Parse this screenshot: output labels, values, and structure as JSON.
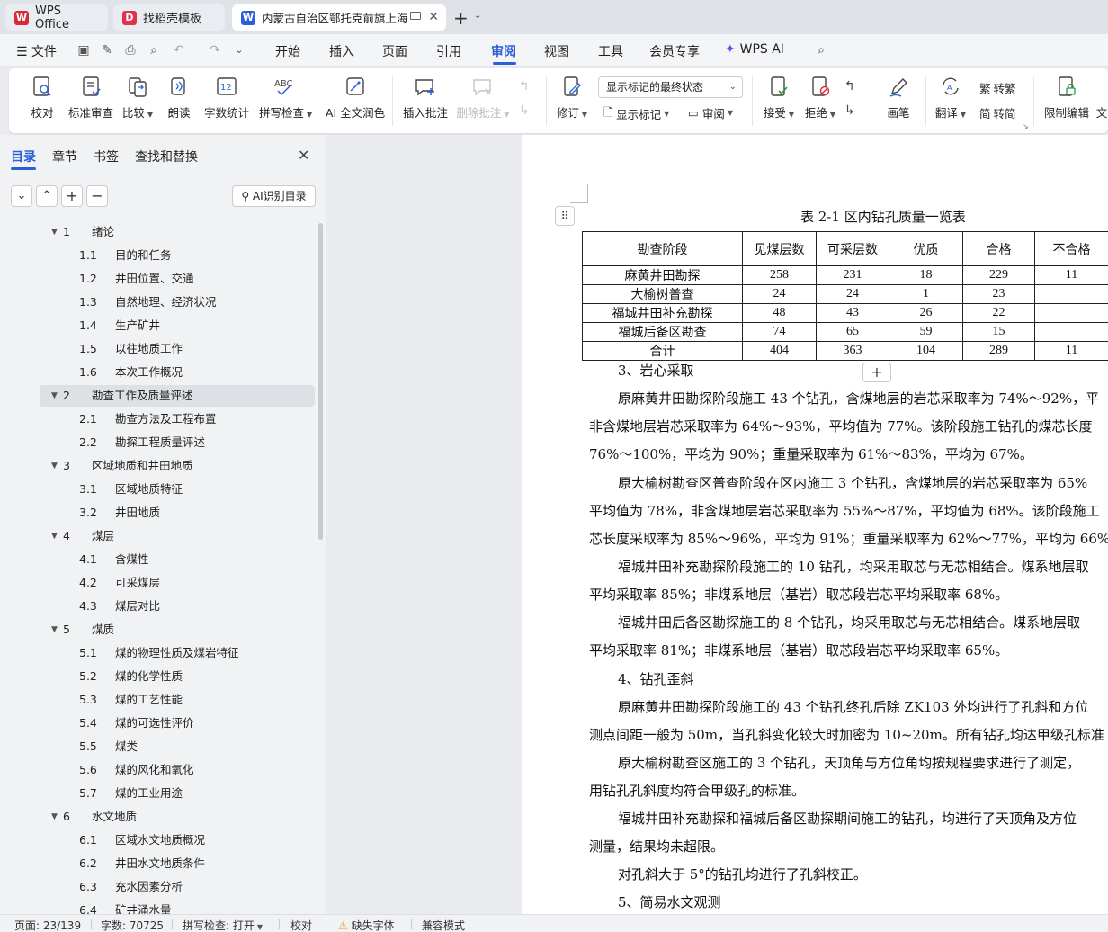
{
  "tabs": [
    {
      "label": "WPS Office",
      "icon": "wps-logo-icon",
      "color": "#d8283a"
    },
    {
      "label": "找稻壳模板",
      "icon": "docer-icon",
      "color": "#e0334a"
    },
    {
      "label": "内蒙古自治区鄂托克前旗上海",
      "icon": "writer-doc-icon",
      "color": "#2b5fd8"
    }
  ],
  "menubar": {
    "file": "文件",
    "items": [
      "开始",
      "插入",
      "页面",
      "引用",
      "审阅",
      "视图",
      "工具",
      "会员专享"
    ],
    "active": "审阅",
    "wps_ai": "WPS AI"
  },
  "ribbon": {
    "proofread": "校对",
    "standard_review": "标准审查",
    "compare": "比较",
    "read_aloud": "朗读",
    "word_count": "字数统计",
    "spell_check": "拼写检查",
    "ai_polish": "AI 全文润色",
    "insert_comment": "插入批注",
    "delete_comment": "删除批注",
    "track_changes": "修订",
    "markup_mode": "显示标记的最终状态",
    "show_markup": "显示标记",
    "review_pane": "审阅",
    "accept": "接受",
    "reject": "拒绝",
    "pen": "画笔",
    "translate": "翻译",
    "to_traditional": "转繁",
    "to_simplified": "转简",
    "restrict_edit": "限制编辑",
    "doc_cut": "文"
  },
  "nav": {
    "tabs": [
      "目录",
      "章节",
      "书签",
      "查找和替换"
    ],
    "active_tab": "目录",
    "ai_toc": "AI识别目录",
    "toc": [
      {
        "num": "1",
        "title": "绪论",
        "level": 1
      },
      {
        "num": "1.1",
        "title": "目的和任务",
        "level": 2
      },
      {
        "num": "1.2",
        "title": "井田位置、交通",
        "level": 2
      },
      {
        "num": "1.3",
        "title": "自然地理、经济状况",
        "level": 2
      },
      {
        "num": "1.4",
        "title": "生产矿井",
        "level": 2
      },
      {
        "num": "1.5",
        "title": "以往地质工作",
        "level": 2
      },
      {
        "num": "1.6",
        "title": "本次工作概况",
        "level": 2
      },
      {
        "num": "2",
        "title": "勘查工作及质量评述",
        "level": 1,
        "selected": true
      },
      {
        "num": "2.1",
        "title": "勘查方法及工程布置",
        "level": 2
      },
      {
        "num": "2.2",
        "title": "勘探工程质量评述",
        "level": 2
      },
      {
        "num": "3",
        "title": "区域地质和井田地质",
        "level": 1
      },
      {
        "num": "3.1",
        "title": "区域地质特征",
        "level": 2
      },
      {
        "num": "3.2",
        "title": "井田地质",
        "level": 2
      },
      {
        "num": "4",
        "title": "煤层",
        "level": 1
      },
      {
        "num": "4.1",
        "title": "含煤性",
        "level": 2
      },
      {
        "num": "4.2",
        "title": "可采煤层",
        "level": 2
      },
      {
        "num": "4.3",
        "title": "煤层对比",
        "level": 2
      },
      {
        "num": "5",
        "title": "煤质",
        "level": 1
      },
      {
        "num": "5.1",
        "title": "煤的物理性质及煤岩特征",
        "level": 2
      },
      {
        "num": "5.2",
        "title": "煤的化学性质",
        "level": 2
      },
      {
        "num": "5.3",
        "title": "煤的工艺性能",
        "level": 2
      },
      {
        "num": "5.4",
        "title": "煤的可选性评价",
        "level": 2
      },
      {
        "num": "5.5",
        "title": "煤类",
        "level": 2
      },
      {
        "num": "5.6",
        "title": "煤的风化和氧化",
        "level": 2
      },
      {
        "num": "5.7",
        "title": "煤的工业用途",
        "level": 2
      },
      {
        "num": "6",
        "title": "水文地质",
        "level": 1
      },
      {
        "num": "6.1",
        "title": "区域水文地质概况",
        "level": 2
      },
      {
        "num": "6.2",
        "title": "井田水文地质条件",
        "level": 2
      },
      {
        "num": "6.3",
        "title": "充水因素分析",
        "level": 2
      },
      {
        "num": "6.4",
        "title": "矿井涌水量",
        "level": 2
      }
    ]
  },
  "document": {
    "table_caption": "表 2-1   区内钻孔质量一览表",
    "table": {
      "headers": [
        "勘查阶段",
        "见煤层数",
        "可采层数",
        "优质",
        "合格",
        "不合格"
      ],
      "rows": [
        [
          "麻黄井田勘探",
          "258",
          "231",
          "18",
          "229",
          "11"
        ],
        [
          "大榆树普查",
          "24",
          "24",
          "1",
          "23",
          ""
        ],
        [
          "福城井田补充勘探",
          "48",
          "43",
          "26",
          "22",
          ""
        ],
        [
          "福城后备区勘查",
          "74",
          "65",
          "59",
          "15",
          ""
        ],
        [
          "合计",
          "404",
          "363",
          "104",
          "289",
          "11"
        ]
      ]
    },
    "lines": [
      "3、岩心采取",
      "原麻黄井田勘探阶段施工 43 个钻孔，含煤地层的岩芯采取率为 74%～92%，平",
      "非含煤地层岩芯采取率为 64%～93%，平均值为 77%。该阶段施工钻孔的煤芯长度",
      "76%～100%，平均为 90%；重量采取率为 61%～83%，平均为 67%。",
      "原大榆树勘查区普查阶段在区内施工 3 个钻孔，含煤地层的岩芯采取率为 65%",
      "平均值为 78%，非含煤地层岩芯采取率为 55%～87%，平均值为 68%。该阶段施工",
      "芯长度采取率为 85%～96%，平均为 91%；重量采取率为 62%～77%，平均为 66%",
      "福城井田补充勘探阶段施工的 10 钻孔，均采用取芯与无芯相结合。煤系地层取",
      "平均采取率 85%；非煤系地层（基岩）取芯段岩芯平均采取率 68%。",
      "福城井田后备区勘探施工的 8 个钻孔，均采用取芯与无芯相结合。煤系地层取",
      "平均采取率 81%；非煤系地层（基岩）取芯段岩芯平均采取率 65%。",
      "4、钻孔歪斜",
      "原麻黄井田勘探阶段施工的 43 个钻孔终孔后除 ZK103 外均进行了孔斜和方位",
      "测点间距一般为 50m，当孔斜变化较大时加密为 10~20m。所有钻孔均达甲级孔标准",
      "原大榆树勘查区施工的 3 个钻孔，天顶角与方位角均按规程要求进行了测定，",
      "用钻孔孔斜度均符合甲级孔的标准。",
      "福城井田补充勘探和福城后备区勘探期间施工的钻孔，均进行了天顶角及方位",
      "测量，结果均未超限。",
      "对孔斜大于 5°的钻孔均进行了孔斜校正。",
      "5、简易水文观测"
    ]
  },
  "status": {
    "page": "页面: 23/139",
    "words": "字数: 70725",
    "spell": "拼写检查: 打开",
    "proof": "校对",
    "missing_font": "缺失字体",
    "compat": "兼容模式"
  },
  "colors": {
    "accent": "#2b5fd8",
    "warning": "#f0a020"
  }
}
